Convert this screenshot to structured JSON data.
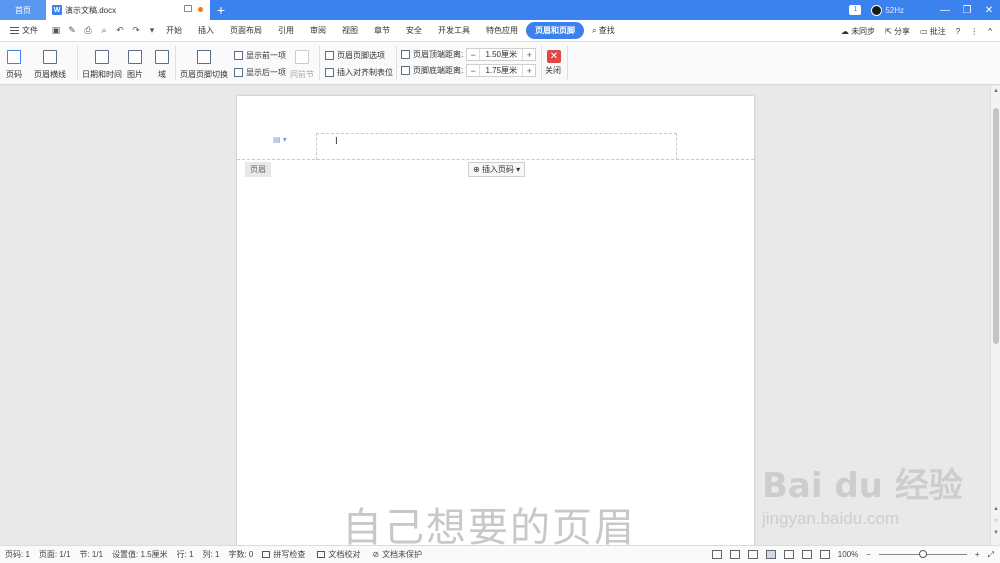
{
  "titlebar": {
    "home_tab": "首页",
    "doc_tab": "演示文稿.docx",
    "new_tab": "+",
    "badge": "1",
    "status_text": "52Hz",
    "window_controls": [
      "—",
      "❐",
      "✕"
    ]
  },
  "menubar": {
    "file": "文件",
    "items": [
      "开始",
      "插入",
      "页面布局",
      "引用",
      "审阅",
      "视图",
      "章节",
      "安全",
      "开发工具",
      "特色应用",
      "页眉和页脚"
    ],
    "active_index": 10,
    "search": "查找",
    "right": {
      "sync": "未同步",
      "share": "分享",
      "comment": "批注"
    }
  },
  "ribbon": {
    "page_number": "页码",
    "header_line": "页眉横线",
    "date_time": "日期和时间",
    "picture": "图片",
    "field": "域",
    "switch": "页眉页脚切换",
    "show_prev": "显示前一项",
    "show_next": "显示后一项",
    "same_as_prev": "同前节",
    "options": "页眉页脚选项",
    "insert_align_tab": "插入对齐制表位",
    "header_top_label": "页眉顶端距离:",
    "header_top_value": "1.50厘米",
    "footer_bottom_label": "页脚底端距离:",
    "footer_bottom_value": "1.75厘米",
    "close": "关闭"
  },
  "page": {
    "header_tag": "页眉",
    "insert_page_number": "插入页码",
    "watermark": "自己想要的页眉"
  },
  "baidu": {
    "logo": "Bai du 经验",
    "url": "jingyan.baidu.com"
  },
  "statusbar": {
    "page": "页码: 1",
    "pages": "页面: 1/1",
    "section": "节: 1/1",
    "setting": "设置值: 1.5厘米",
    "row": "行: 1",
    "col": "列: 1",
    "words": "字数: 0",
    "spell": "拼写检查",
    "proof": "文档校对",
    "protect": "文档未保护",
    "zoom": "100%"
  }
}
